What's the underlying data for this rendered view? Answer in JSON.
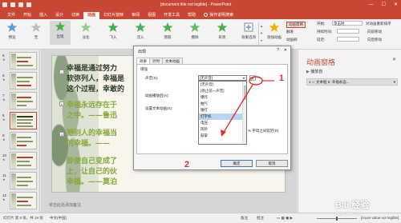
{
  "titlebar": {
    "title": "[document title not legible] - PowerPoint",
    "minimize": "—",
    "maximize": "☐",
    "close": "✕"
  },
  "tabs": [
    {
      "label": "文件",
      "active": false
    },
    {
      "label": "开始",
      "active": false
    },
    {
      "label": "插入",
      "active": false
    },
    {
      "label": "设计",
      "active": false
    },
    {
      "label": "切换",
      "active": false
    },
    {
      "label": "动画",
      "active": true
    },
    {
      "label": "幻灯片放映",
      "active": false
    },
    {
      "label": "审阅",
      "active": false
    },
    {
      "label": "视图",
      "active": false
    },
    {
      "label": "开发工具",
      "active": false
    },
    {
      "label": "帮助",
      "active": false
    },
    {
      "label": "操作说明搜索",
      "active": false
    }
  ],
  "ribbon": {
    "preview": "预览",
    "effects": [
      {
        "label": "无",
        "icon": "none-star-icon"
      },
      {
        "label": "出现",
        "icon": "appear-star-icon",
        "selected": true
      },
      {
        "label": "淡化",
        "icon": "fade-star-icon"
      },
      {
        "label": "飞入",
        "icon": "fly-in-star-icon"
      },
      {
        "label": "浮入",
        "icon": "float-in-star-icon"
      },
      {
        "label": "劈裂",
        "icon": "split-star-icon"
      },
      {
        "label": "擦除",
        "icon": "wipe-star-icon"
      },
      {
        "label": "形状",
        "icon": "shape-star-icon"
      }
    ],
    "effect_options": "效果选项",
    "add_animation": "添加动画",
    "animation_pane": "动画窗格",
    "trigger": "触发",
    "animation_painter": "动画刷",
    "start_label": "开始:",
    "start_value": "单击时",
    "duration_label": "持续时间:",
    "delay_label": "延迟:",
    "reorder_label": "对动画重新排序",
    "move_earlier": "向前移动",
    "move_later": "向后移动"
  },
  "thumbnails": [
    {
      "number": "5"
    },
    {
      "number": "6"
    },
    {
      "number": "7"
    },
    {
      "number": "8",
      "active": true
    },
    {
      "number": "9"
    },
    {
      "number": "10"
    },
    {
      "number": "11"
    },
    {
      "number": "12"
    }
  ],
  "slide": {
    "lines": [
      {
        "text": "幸福是通过努力",
        "color": "dark"
      },
      {
        "text": "软弥列人，幸福是",
        "color": "dark"
      },
      {
        "text": "这个过程，幸敢的",
        "color": "dark"
      },
      {
        "text": "幸福永远存在于",
        "color": "green"
      },
      {
        "text": "之中。——鲁迅",
        "color": "green"
      },
      {
        "text": "把别人的幸福当",
        "color": "green"
      },
      {
        "text": "的幸福。——",
        "color": "green"
      },
      {
        "text": "即使自己变成了",
        "color": "green"
      },
      {
        "text": "上，让自己的伙",
        "color": "green"
      },
      {
        "text": "幸福。——莫泊",
        "color": "green"
      }
    ],
    "tags": [
      "1",
      "0",
      "3"
    ],
    "notes_placeholder": "单击此处添加备注"
  },
  "anim_pane": {
    "title": "动画窗格",
    "close": "✕",
    "play_label": "播放自",
    "item_label": "1 ☆ 文本框 5: 幸福永远..."
  },
  "dialog": {
    "title": "出现",
    "help": "?",
    "close": "✕",
    "tabs": [
      "效果",
      "计时",
      "文本动画"
    ],
    "group_label": "增强",
    "sound_label": "声音(S):",
    "sound_value": "[无声音]",
    "after_anim_label": "动画播放后(A):",
    "animate_text_label": "设置文本动画(X):",
    "delay_suffix": "% 字母之间延迟(D)",
    "list_options": [
      {
        "label": "[无声音]",
        "selected": false
      },
      {
        "label": "[停止前一声音]",
        "selected": false
      },
      {
        "label": "爆炸",
        "selected": false
      },
      {
        "label": "抽气",
        "selected": false
      },
      {
        "label": "锤打",
        "selected": false
      },
      {
        "label": "打字机",
        "selected": true
      },
      {
        "label": "电压",
        "selected": false
      },
      {
        "label": "风铃",
        "selected": false
      },
      {
        "label": "鼓掌",
        "selected": false
      }
    ],
    "ok": "确定",
    "cancel": "取消"
  },
  "annotations": {
    "step1": "1",
    "step2": "2",
    "color": "#e0312a"
  },
  "statusbar": {
    "slide_info": "幻灯片 第 8 张，共 19 张",
    "language": "中文(中国)",
    "notes": "备注",
    "comments": "批注",
    "zoom": "[zoom value not legible]"
  },
  "watermark": {
    "text": "Bai 经验",
    "sub": "jingyan.baidu.com"
  },
  "colors": {
    "accent": "#c74634",
    "slide_dark_text": "#2f3a2a",
    "slide_green_text": "#86a838",
    "selected_option": "#b9d4f0"
  }
}
